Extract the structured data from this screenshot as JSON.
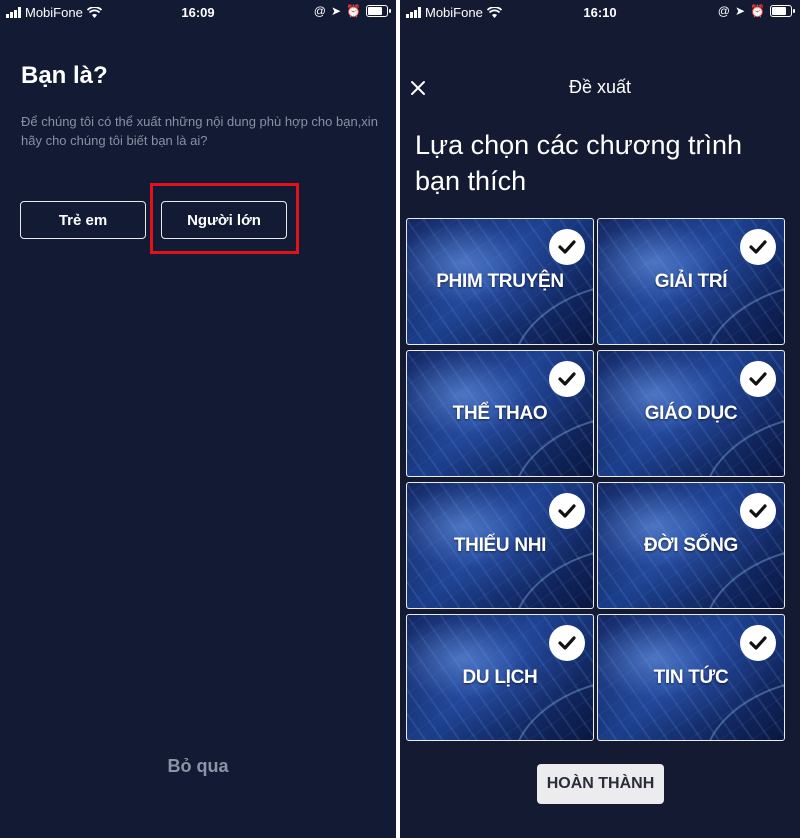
{
  "left_screen": {
    "status": {
      "carrier": "MobiFone",
      "time": "16:09"
    },
    "title": "Bạn là?",
    "description": "Để chúng tôi có thể xuất những nội dung phù hợp cho bạn,xin hãy cho chúng tôi biết bạn là ai?",
    "options": [
      {
        "label": "Trẻ em"
      },
      {
        "label": "Người lớn"
      }
    ],
    "skip_label": "Bỏ qua"
  },
  "right_screen": {
    "status": {
      "carrier": "MobiFone",
      "time": "16:10"
    },
    "header_title": "Đề xuất",
    "close_icon": "close-icon",
    "heading": "Lựa chọn các chương trình bạn thích",
    "categories": [
      {
        "label": "PHIM TRUYỆN",
        "selected": true
      },
      {
        "label": "GIẢI TRÍ",
        "selected": true
      },
      {
        "label": "THỂ THAO",
        "selected": true
      },
      {
        "label": "GIÁO DỤC",
        "selected": true
      },
      {
        "label": "THIẾU NHI",
        "selected": true
      },
      {
        "label": "ĐỜI SỐNG",
        "selected": true
      },
      {
        "label": "DU LỊCH",
        "selected": true
      },
      {
        "label": "TIN TỨC",
        "selected": true
      }
    ],
    "done_label": "HOÀN THÀNH"
  },
  "colors": {
    "background": "#131a33",
    "highlight": "#e0131b",
    "muted_text": "#8a90a3"
  }
}
